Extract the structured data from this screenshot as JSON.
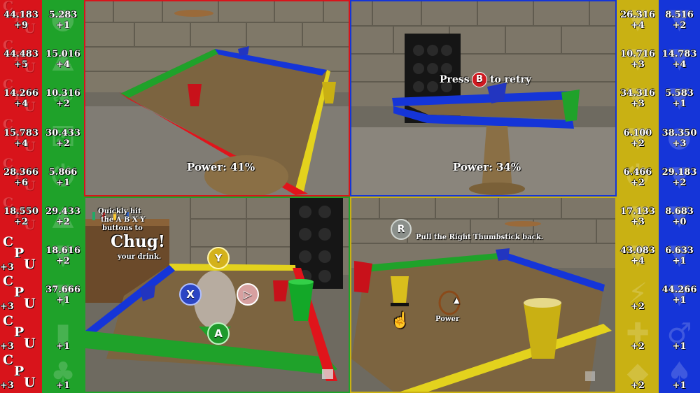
{
  "colors": {
    "red": "#d8141b",
    "green": "#1fa22a",
    "yellow": "#c9b113",
    "blue": "#1535d8"
  },
  "scoreboards": {
    "red": [
      {
        "value": "44.183",
        "delta": "+9",
        "cpu": false
      },
      {
        "value": "44.483",
        "delta": "+5",
        "cpu": false
      },
      {
        "value": "14.266",
        "delta": "+4",
        "cpu": false
      },
      {
        "value": "15.783",
        "delta": "+4",
        "cpu": false
      },
      {
        "value": "28.366",
        "delta": "+6",
        "cpu": false
      },
      {
        "value": "18.550",
        "delta": "+2",
        "cpu": false
      },
      {
        "value": "",
        "delta": "+3",
        "cpu": true
      },
      {
        "value": "",
        "delta": "+3",
        "cpu": true
      },
      {
        "value": "",
        "delta": "+3",
        "cpu": true
      },
      {
        "value": "",
        "delta": "+3",
        "cpu": true
      }
    ],
    "green": [
      {
        "value": "5.283",
        "delta": "+1",
        "icon": "drop-icon"
      },
      {
        "value": "15.016",
        "delta": "+4",
        "icon": "frog-icon"
      },
      {
        "value": "10.316",
        "delta": "+2",
        "icon": "leaf-icon"
      },
      {
        "value": "30.433",
        "delta": "+2",
        "icon": "die-icon"
      },
      {
        "value": "5.866",
        "delta": "+1",
        "icon": "power-icon"
      },
      {
        "value": "29.433",
        "delta": "+2",
        "icon": "frog-icon"
      },
      {
        "value": "18.616",
        "delta": "+2",
        "icon": "cup-icon"
      },
      {
        "value": "37.666",
        "delta": "+1",
        "icon": "cup-icon"
      },
      {
        "value": "",
        "delta": "+1",
        "icon": "mouse-icon"
      },
      {
        "value": "",
        "delta": "+1",
        "icon": "club-icon"
      }
    ],
    "yellow": [
      {
        "value": "26.316",
        "delta": "+4",
        "icon": "cup-icon"
      },
      {
        "value": "10.716",
        "delta": "+3",
        "icon": "cup-icon"
      },
      {
        "value": "34.316",
        "delta": "+3",
        "icon": "cup-icon"
      },
      {
        "value": "6.100",
        "delta": "+2",
        "icon": "cup-icon"
      },
      {
        "value": "6.466",
        "delta": "+2",
        "icon": "power-icon"
      },
      {
        "value": "17.133",
        "delta": "+3",
        "icon": "cup-icon"
      },
      {
        "value": "43.083",
        "delta": "+4",
        "icon": "cup-icon"
      },
      {
        "value": "",
        "delta": "+2",
        "icon": "lightning-icon"
      },
      {
        "value": "",
        "delta": "+2",
        "icon": "plus-icon"
      },
      {
        "value": "",
        "delta": "+2",
        "icon": "diamond-icon"
      }
    ],
    "blue": [
      {
        "value": "8.516",
        "delta": "+2",
        "icon": "cup-icon"
      },
      {
        "value": "14.783",
        "delta": "+4",
        "icon": "cup-icon"
      },
      {
        "value": "5.583",
        "delta": "+1",
        "icon": "cup-icon"
      },
      {
        "value": "38.350",
        "delta": "+3",
        "icon": "drop-icon"
      },
      {
        "value": "29.183",
        "delta": "+2",
        "icon": "cup-icon"
      },
      {
        "value": "8.683",
        "delta": "+0",
        "icon": "cup-icon"
      },
      {
        "value": "6.633",
        "delta": "+1",
        "icon": "cup-icon"
      },
      {
        "value": "44.266",
        "delta": "+1",
        "icon": "cup-icon"
      },
      {
        "value": "",
        "delta": "+1",
        "icon": "male-icon"
      },
      {
        "value": "",
        "delta": "+1",
        "icon": "spade-icon"
      }
    ]
  },
  "cpu_letters": {
    "c": "C",
    "p": "P",
    "u": "U"
  },
  "views": {
    "red": {
      "power": "Power: 41%"
    },
    "blue": {
      "power": "Power: 34%",
      "press": "Press",
      "button": "B",
      "retry": "to retry"
    },
    "green": {
      "hint_line1": "Quickly hit",
      "hint_line2": "the A B X Y",
      "hint_line3": "buttons to",
      "chug": "Chug!",
      "hint_line4": "your drink.",
      "button_y": "Y",
      "button_x": "X",
      "button_a": "A"
    },
    "yellow": {
      "button_r": "R",
      "instruction": "Pull the Right Thumbstick back.",
      "power_label": "Power"
    }
  }
}
